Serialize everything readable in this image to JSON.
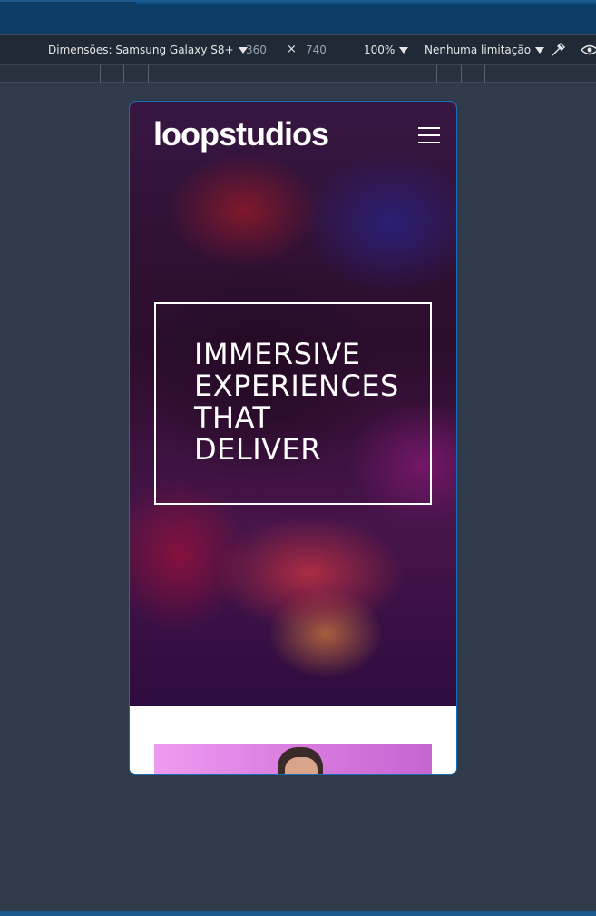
{
  "devtools": {
    "dimensions_label": "Dimensões: Samsung Galaxy S8+",
    "width": "360",
    "times": "×",
    "height": "740",
    "zoom": "100%",
    "throttling": "Nenhuma limitação"
  },
  "site": {
    "logo": "loopstudios",
    "hero_lines": [
      "IMMERSIVE",
      "EXPERIENCES",
      "THAT",
      "DELIVER"
    ]
  },
  "colors": {
    "page_bg": "#2f3b4b",
    "browser_bar": "#0b3d66",
    "devtools_bar": "#202a36",
    "hero_text": "#ffffff"
  },
  "icons": [
    "chevron-down-icon",
    "eyedropper-icon",
    "eye-icon",
    "hamburger-menu-icon"
  ]
}
